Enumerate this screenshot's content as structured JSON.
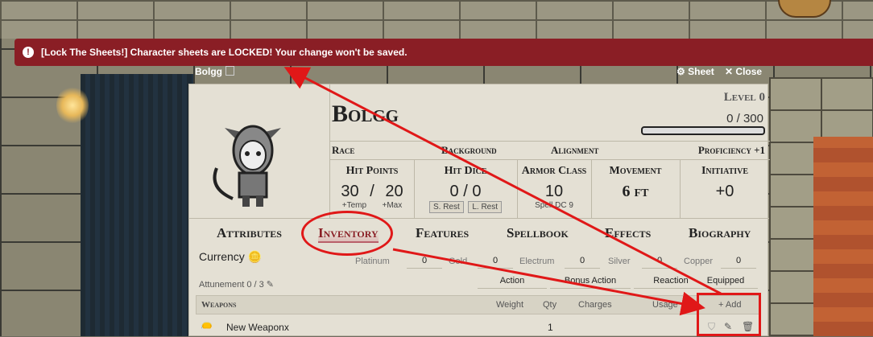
{
  "banner": {
    "message": "[Lock The Sheets!] Character sheets are LOCKED! Your change won't be saved.",
    "icon": "exclamation-icon"
  },
  "titlebar": {
    "name": "Bolgg",
    "sheet_label": "Sheet",
    "close_label": "Close"
  },
  "character": {
    "name": "Bolgg",
    "level": "Level 0",
    "xp": "0 / 300",
    "race_label": "Race",
    "background_label": "Background",
    "alignment_label": "Alignment",
    "proficiency": "Proficiency +1"
  },
  "stats": {
    "hit_points": {
      "label": "Hit Points",
      "current": "30",
      "sep": "/",
      "max": "20",
      "temp": "+Temp",
      "plus_max": "+Max"
    },
    "hit_dice": {
      "label": "Hit Dice",
      "value": "0 / 0",
      "short_rest": "S. Rest",
      "long_rest": "L. Rest"
    },
    "armor_class": {
      "label": "Armor Class",
      "value": "10",
      "spell_dc": "Spell DC 9"
    },
    "movement": {
      "label": "Movement",
      "value": "6 ft"
    },
    "initiative": {
      "label": "Initiative",
      "value": "+0"
    }
  },
  "tabs": [
    "Attributes",
    "Inventory",
    "Features",
    "Spellbook",
    "Effects",
    "Biography"
  ],
  "active_tab": "Inventory",
  "currency": {
    "label": "Currency",
    "coins": [
      {
        "name": "Platinum",
        "value": "0"
      },
      {
        "name": "Gold",
        "value": "0"
      },
      {
        "name": "Electrum",
        "value": "0"
      },
      {
        "name": "Silver",
        "value": "0"
      },
      {
        "name": "Copper",
        "value": "0"
      }
    ]
  },
  "attunement": "Attunement 0 / 3",
  "filters": [
    "Action",
    "Bonus Action",
    "Reaction",
    "Equipped"
  ],
  "weapons_table": {
    "header": "Weapons",
    "columns": [
      "Weight",
      "Qty",
      "Charges",
      "Usage"
    ],
    "add_label": "+ Add",
    "rows": [
      {
        "name": "New Weaponx",
        "qty": "1"
      }
    ]
  },
  "colors": {
    "banner": "#8a1e25",
    "annotation": "#e01818",
    "sheet_bg": "#e4e0d4"
  }
}
